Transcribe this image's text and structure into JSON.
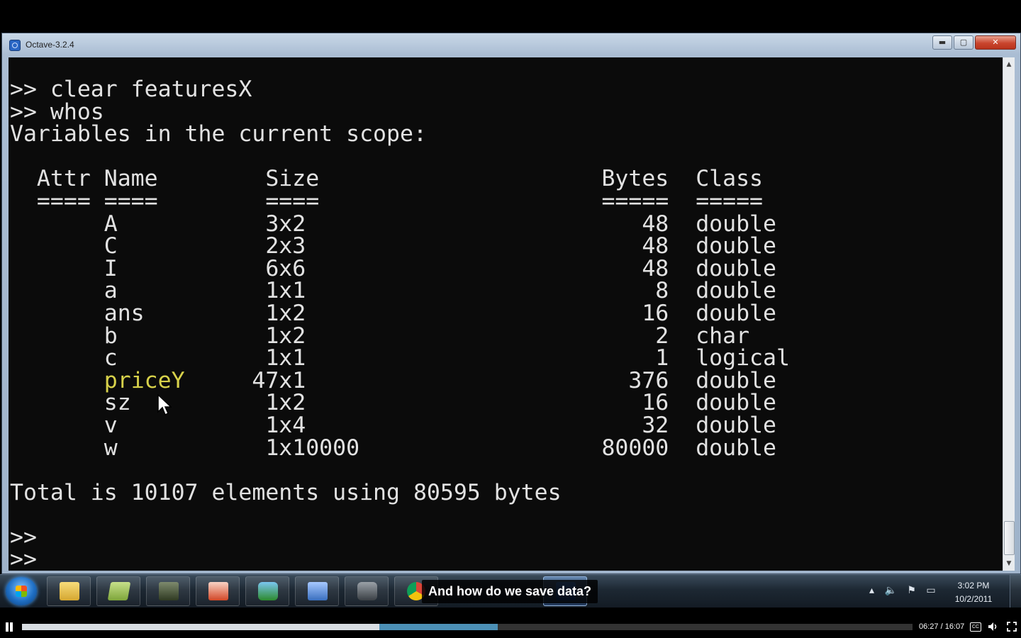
{
  "window": {
    "title": "Octave-3.2.4",
    "buttons": {
      "minimize": "▬",
      "maximize": "▢",
      "close": "✕"
    }
  },
  "console": {
    "lines": [
      ">> clear featuresX",
      ">> whos",
      "Variables in the current scope:",
      "",
      "  Attr Name        Size                     Bytes  Class",
      "  ==== ====        ====                     =====  =====",
      "       A           3x2                         48  double",
      "       C           2x3                         48  double",
      "       I           6x6                         48  double",
      "       a           1x1                          8  double",
      "       ans         1x2                         16  double",
      "       b           1x2                          2  char",
      "       c           1x1                          1  logical",
      "HL:       priceY     47x1                        376  double",
      "       sz          1x2                         16  double",
      "       v           1x4                         32  double",
      "       w           1x10000                  80000  double",
      "",
      "Total is 10107 elements using 80595 bytes",
      "",
      ">>",
      ">>"
    ],
    "highlight_color": "#d7d14a",
    "text_color": "#e2e2e2",
    "background_color": "#0b0b0b"
  },
  "taskbar": {
    "items": [
      "start",
      "explorer",
      "notes",
      "gallery",
      "powerpoint",
      "network",
      "remote",
      "camera",
      "chrome",
      "octave"
    ],
    "clock_time": "3:02 PM",
    "clock_date": "10/2/2011",
    "tray_icons": [
      "chevron-up-icon",
      "speaker-icon",
      "flag-icon",
      "network-icon"
    ]
  },
  "caption": {
    "text": "And how do we save data?"
  },
  "player": {
    "time": "06:27 / 16:07",
    "played_fraction": 0.401,
    "buffered_fraction": 0.534,
    "cc_label": "CC"
  },
  "colors": {
    "accent": "#4c90b6",
    "close_button": "#c9452e"
  }
}
